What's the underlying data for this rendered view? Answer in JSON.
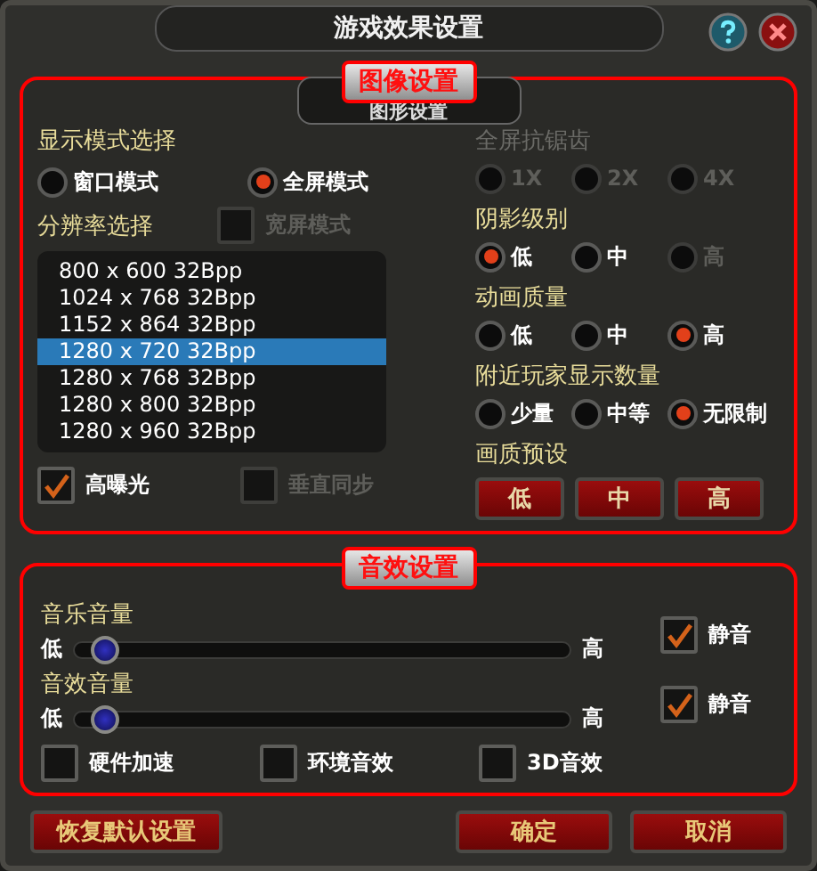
{
  "window": {
    "title": "游戏效果设置"
  },
  "graphics": {
    "badge": "图像设置",
    "header": "图形设置",
    "display_mode": {
      "label": "显示模式选择",
      "options": [
        {
          "label": "窗口模式",
          "selected": false
        },
        {
          "label": "全屏模式",
          "selected": true
        }
      ]
    },
    "resolution": {
      "label": "分辨率选择",
      "widescreen": {
        "label": "宽屏模式",
        "checked": false,
        "disabled": true
      },
      "items": [
        {
          "label": "800 x 600 32Bpp",
          "selected": false
        },
        {
          "label": "1024 x 768 32Bpp",
          "selected": false
        },
        {
          "label": "1152 x 864 32Bpp",
          "selected": false
        },
        {
          "label": "1280 x 720 32Bpp",
          "selected": true
        },
        {
          "label": "1280 x 768 32Bpp",
          "selected": false
        },
        {
          "label": "1280 x 800 32Bpp",
          "selected": false
        },
        {
          "label": "1280 x 960 32Bpp",
          "selected": false
        }
      ]
    },
    "toggles": [
      {
        "label": "高曝光",
        "checked": true,
        "disabled": false
      },
      {
        "label": "垂直同步",
        "checked": false,
        "disabled": true
      }
    ],
    "groups": [
      {
        "label": "全屏抗锯齿",
        "disabled": true,
        "options": [
          {
            "label": "1X",
            "selected": false,
            "disabled": true
          },
          {
            "label": "2X",
            "selected": false,
            "disabled": true
          },
          {
            "label": "4X",
            "selected": false,
            "disabled": true
          }
        ]
      },
      {
        "label": "阴影级别",
        "disabled": false,
        "options": [
          {
            "label": "低",
            "selected": true,
            "disabled": false
          },
          {
            "label": "中",
            "selected": false,
            "disabled": false
          },
          {
            "label": "高",
            "selected": false,
            "disabled": true
          }
        ]
      },
      {
        "label": "动画质量",
        "disabled": false,
        "options": [
          {
            "label": "低",
            "selected": false,
            "disabled": false
          },
          {
            "label": "中",
            "selected": false,
            "disabled": false
          },
          {
            "label": "高",
            "selected": true,
            "disabled": false
          }
        ]
      },
      {
        "label": "附近玩家显示数量",
        "disabled": false,
        "options": [
          {
            "label": "少量",
            "selected": false,
            "disabled": false
          },
          {
            "label": "中等",
            "selected": false,
            "disabled": false
          },
          {
            "label": "无限制",
            "selected": true,
            "disabled": false
          }
        ]
      }
    ],
    "presets": {
      "label": "画质预设",
      "buttons": [
        "低",
        "中",
        "高"
      ]
    }
  },
  "audio": {
    "badge": "音效设置",
    "volumes": [
      {
        "label": "音乐音量",
        "low": "低",
        "high": "高",
        "level": 0.06,
        "mute": {
          "label": "静音",
          "checked": true
        }
      },
      {
        "label": "音效音量",
        "low": "低",
        "high": "高",
        "level": 0.06,
        "mute": {
          "label": "静音",
          "checked": true
        }
      }
    ],
    "options": [
      {
        "label": "硬件加速",
        "checked": false
      },
      {
        "label": "环境音效",
        "checked": false
      },
      {
        "label": "3D音效",
        "checked": false
      }
    ]
  },
  "buttons": {
    "reset": "恢复默认设置",
    "ok": "确定",
    "cancel": "取消"
  }
}
